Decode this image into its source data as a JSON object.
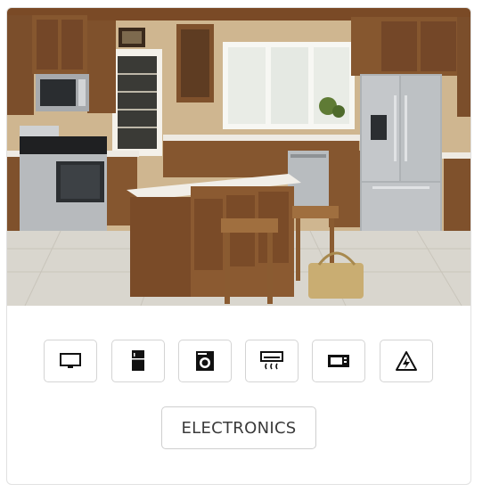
{
  "photo": {
    "subject": "kitchen-appliances-scene",
    "colors": {
      "cabinet_wood": "#7a4d2a",
      "countertop": "#f1eee8",
      "wall": "#cdb48f",
      "floor": "#d8d5cd",
      "stainless": "#b9bcbf"
    }
  },
  "appliance_icons": [
    {
      "icon": "tv-icon",
      "active": false
    },
    {
      "icon": "refrigerator-icon",
      "active": false
    },
    {
      "icon": "washing-machine-icon",
      "active": false
    },
    {
      "icon": "air-conditioner-icon",
      "active": false
    },
    {
      "icon": "microwave-icon",
      "active": false
    },
    {
      "icon": "electrical-hazard-icon",
      "active": false
    }
  ],
  "category_button": {
    "label": "ELECTRONICS"
  }
}
